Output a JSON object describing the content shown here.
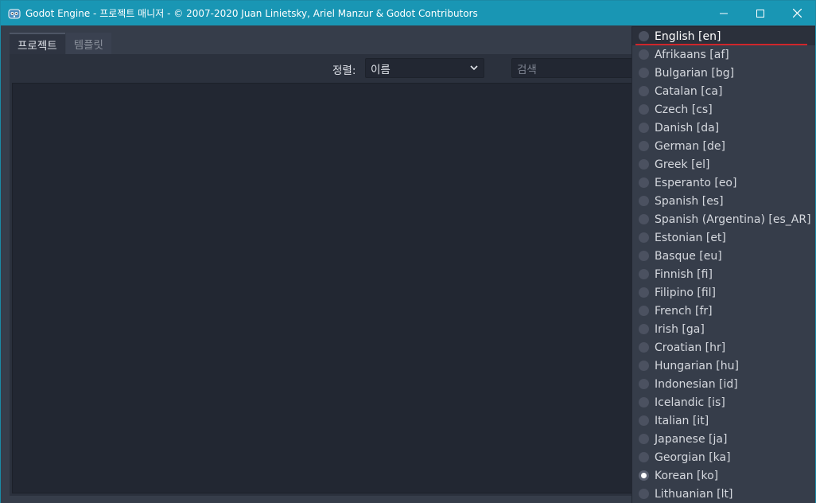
{
  "window": {
    "title": "Godot Engine - 프로젝트 매니저 - © 2007-2020 Juan Linietsky, Ariel Manzur & Godot Contributors",
    "app_icon": "godot-icon",
    "controls": [
      "minimize-icon",
      "maximize-icon",
      "close-icon"
    ]
  },
  "tabs": [
    {
      "label": "프로젝트",
      "active": true
    },
    {
      "label": "템플릿",
      "active": false
    }
  ],
  "toolbar": {
    "sort_label": "정렬:",
    "sort_value": "이름",
    "search_placeholder": "검색"
  },
  "language_menu": {
    "items": [
      {
        "label": "English [en]",
        "checked": false,
        "hovered": true
      },
      {
        "label": "Afrikaans [af]",
        "checked": false
      },
      {
        "label": "Bulgarian [bg]",
        "checked": false
      },
      {
        "label": "Catalan [ca]",
        "checked": false
      },
      {
        "label": "Czech [cs]",
        "checked": false
      },
      {
        "label": "Danish [da]",
        "checked": false
      },
      {
        "label": "German [de]",
        "checked": false
      },
      {
        "label": "Greek [el]",
        "checked": false
      },
      {
        "label": "Esperanto [eo]",
        "checked": false
      },
      {
        "label": "Spanish [es]",
        "checked": false
      },
      {
        "label": "Spanish (Argentina) [es_AR]",
        "checked": false
      },
      {
        "label": "Estonian [et]",
        "checked": false
      },
      {
        "label": "Basque [eu]",
        "checked": false
      },
      {
        "label": "Finnish [fi]",
        "checked": false
      },
      {
        "label": "Filipino [fil]",
        "checked": false
      },
      {
        "label": "French [fr]",
        "checked": false
      },
      {
        "label": "Irish [ga]",
        "checked": false
      },
      {
        "label": "Croatian [hr]",
        "checked": false
      },
      {
        "label": "Hungarian [hu]",
        "checked": false
      },
      {
        "label": "Indonesian [id]",
        "checked": false
      },
      {
        "label": "Icelandic [is]",
        "checked": false
      },
      {
        "label": "Italian [it]",
        "checked": false
      },
      {
        "label": "Japanese [ja]",
        "checked": false
      },
      {
        "label": "Georgian [ka]",
        "checked": false
      },
      {
        "label": "Korean [ko]",
        "checked": true
      },
      {
        "label": "Lithuanian [lt]",
        "checked": false
      }
    ]
  },
  "colors": {
    "titlebar": "#1996b4",
    "background": "#363d4a",
    "panel": "#2b313d",
    "input": "#222732",
    "hover_underline": "#d0262b"
  }
}
